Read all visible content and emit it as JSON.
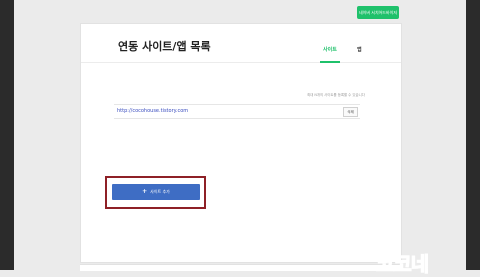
{
  "header": {
    "top_button_label": "네이버 서치어드바이저"
  },
  "card": {
    "title": "연동 사이트/앱 목록",
    "tabs": [
      {
        "label": "사이트",
        "active": true
      },
      {
        "label": "앱",
        "active": false
      }
    ],
    "hint_text": "최대 N개의 사이트를 등록할 수 있습니다",
    "sites": [
      {
        "url": "http://cocohouse.tistory.com",
        "delete_label": "삭제"
      }
    ],
    "add_button_label": "사이트 추가"
  },
  "watermark": "코코네",
  "colors": {
    "brand_green": "#1fc16b",
    "add_button_blue": "#3e6dc4",
    "highlight_box": "#8e2026",
    "watermark_red": "#e8203a"
  }
}
